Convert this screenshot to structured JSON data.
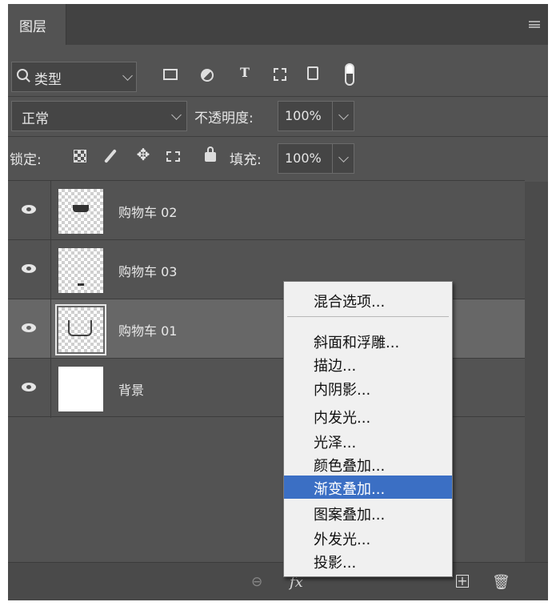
{
  "panel": {
    "tab_title": "图层",
    "filter": {
      "label": "类型"
    },
    "blend_mode": "正常",
    "opacity_label": "不透明度:",
    "opacity_value": "100%",
    "lock_label": "锁定:",
    "fill_label": "填充:",
    "fill_value": "100%"
  },
  "layers": [
    {
      "name": "购物车 02",
      "selected": false,
      "thumb": "transparent"
    },
    {
      "name": "购物车 03",
      "selected": false,
      "thumb": "transparent"
    },
    {
      "name": "购物车 01",
      "selected": true,
      "thumb": "transparent"
    },
    {
      "name": "背景",
      "selected": false,
      "thumb": "white"
    }
  ],
  "context_menu": {
    "items": [
      "混合选项...",
      "斜面和浮雕...",
      "描边...",
      "内阴影...",
      "内发光...",
      "光泽...",
      "颜色叠加...",
      "渐变叠加...",
      "图案叠加...",
      "外发光...",
      "投影..."
    ],
    "highlighted": "渐变叠加..."
  },
  "colors": {
    "panel_bg": "#535353",
    "selected_row": "#676767",
    "menu_highlight": "#3b6fc4"
  }
}
